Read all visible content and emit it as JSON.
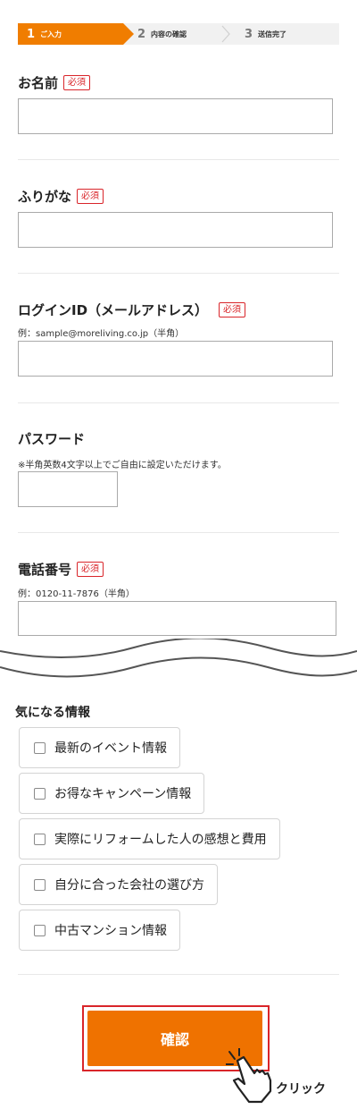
{
  "steps": [
    {
      "num": "1",
      "label": "ご入力"
    },
    {
      "num": "2",
      "label": "内容の確認"
    },
    {
      "num": "3",
      "label": "送信完了"
    }
  ],
  "fields": {
    "name": {
      "label": "お名前",
      "required": "必須",
      "value": ""
    },
    "furigana": {
      "label": "ふりがな",
      "required": "必須",
      "value": ""
    },
    "login_id": {
      "label": "ログインID（メールアドレス）",
      "required": "必須",
      "note": "例：sample@moreliving.co.jp（半角）",
      "value": ""
    },
    "password": {
      "label": "パスワード",
      "note": "※半角英数4文字以上でご自由に設定いただけます。",
      "value": ""
    },
    "phone": {
      "label": "電話番号",
      "required": "必須",
      "note": "例：0120-11-7876（半角）",
      "value": ""
    }
  },
  "interests": {
    "title": "気になる情報",
    "options": [
      {
        "label": "最新のイベント情報",
        "checked": false
      },
      {
        "label": "お得なキャンペーン情報",
        "checked": false
      },
      {
        "label": "実際にリフォームした人の感想と費用",
        "checked": false
      },
      {
        "label": "自分に合った会社の選び方",
        "checked": false
      },
      {
        "label": "中古マンション情報",
        "checked": false
      }
    ]
  },
  "confirm": {
    "label": "確認"
  },
  "click_hint": "クリック",
  "colors": {
    "accent": "#f07d00",
    "required": "#d9252a",
    "button": "#ef7200"
  },
  "icons": {
    "cursor": "hand-pointer-icon",
    "step_separator": "chevron-right-icon",
    "checkbox": "checkbox-icon"
  }
}
